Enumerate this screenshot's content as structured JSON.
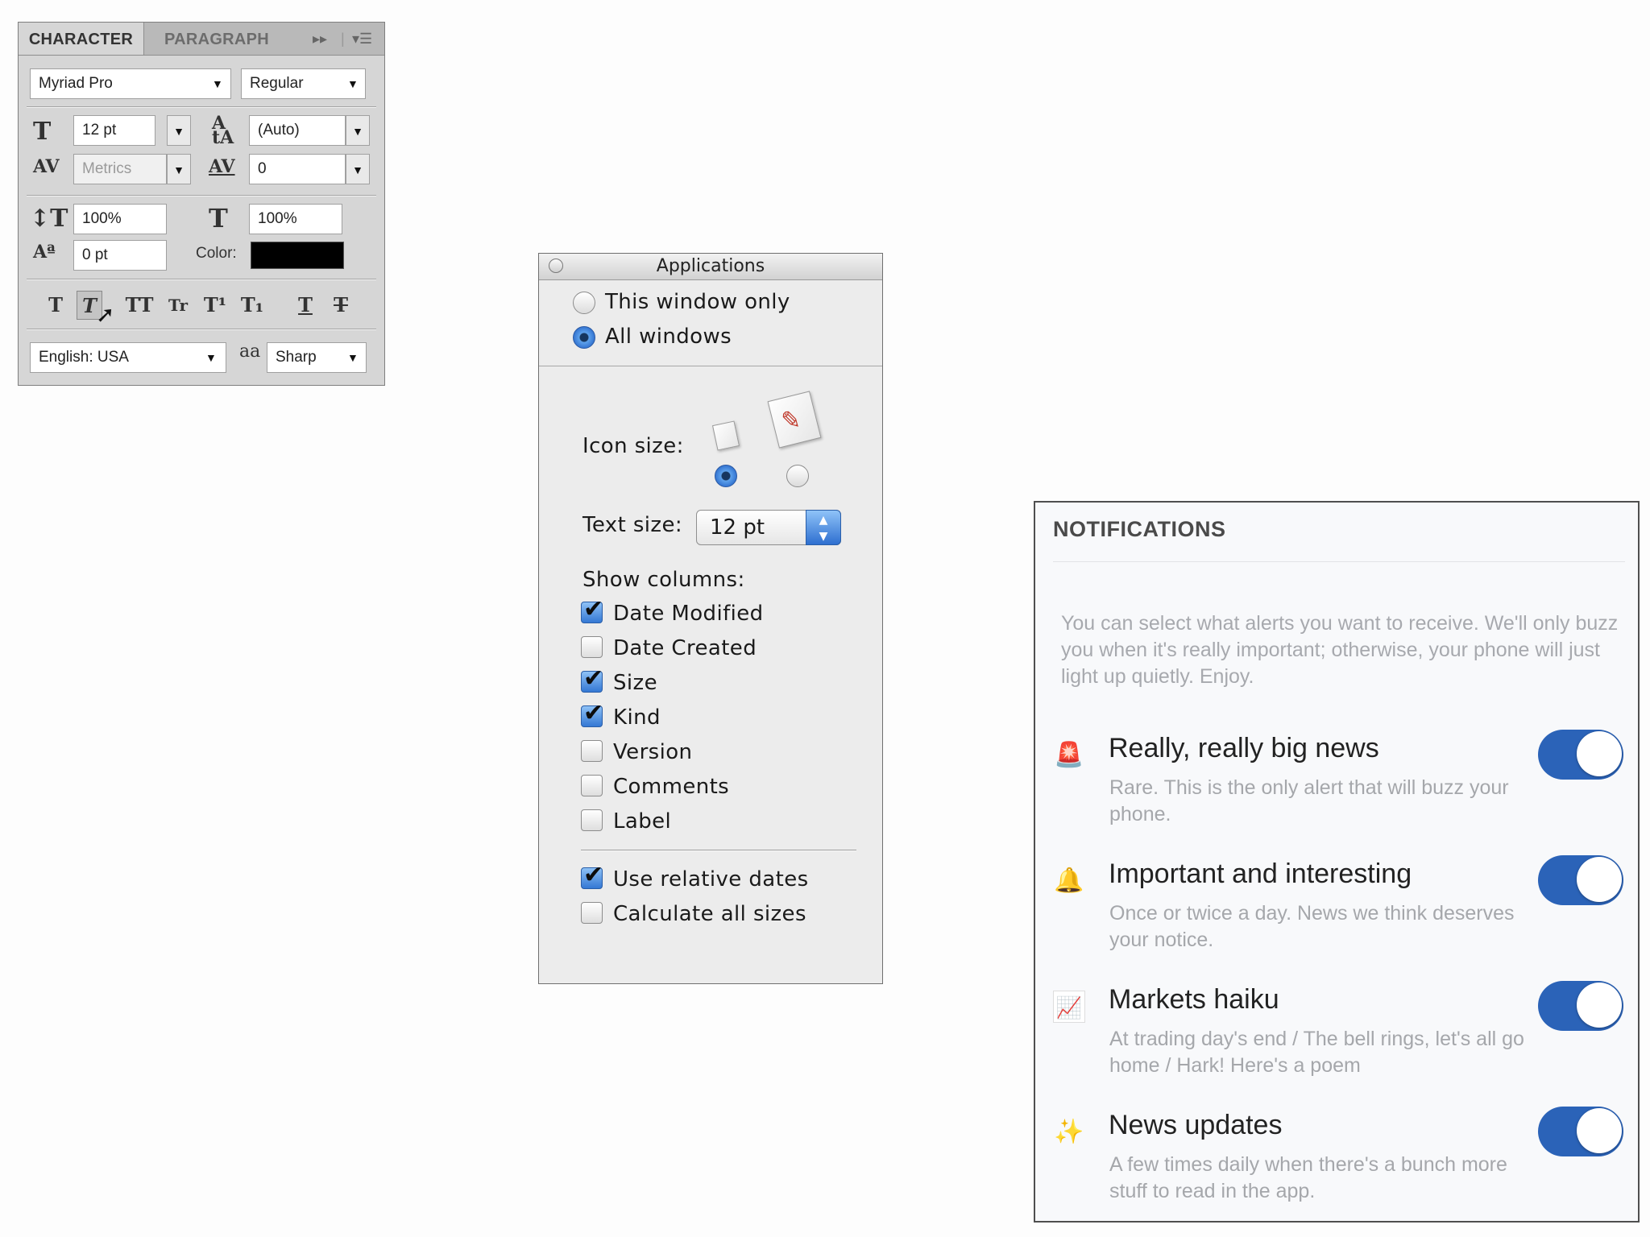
{
  "character_panel": {
    "tabs": [
      "CHARACTER",
      "PARAGRAPH"
    ],
    "font_family": "Myriad Pro",
    "font_style": "Regular",
    "font_size": "12 pt",
    "leading": "(Auto)",
    "kerning": "Metrics",
    "tracking": "0",
    "vertical_scale": "100%",
    "horizontal_scale": "100%",
    "baseline_shift": "0 pt",
    "color_label": "Color:",
    "color_value": "#000000",
    "style_buttons": [
      "T",
      "T",
      "TT",
      "Tr",
      "T¹",
      "T₁",
      "T",
      "T"
    ],
    "language": "English: USA",
    "anti_alias_icon": "aa",
    "anti_alias": "Sharp"
  },
  "apps_window": {
    "title": "Applications",
    "scope_options": [
      {
        "label": "This window only",
        "selected": false
      },
      {
        "label": "All windows",
        "selected": true
      }
    ],
    "icon_size_label": "Icon size:",
    "icon_size_selected": "small",
    "text_size_label": "Text size:",
    "text_size": "12 pt",
    "show_columns_label": "Show columns:",
    "columns": [
      {
        "label": "Date Modified",
        "checked": true
      },
      {
        "label": "Date Created",
        "checked": false
      },
      {
        "label": "Size",
        "checked": true
      },
      {
        "label": "Kind",
        "checked": true
      },
      {
        "label": "Version",
        "checked": false
      },
      {
        "label": "Comments",
        "checked": false
      },
      {
        "label": "Label",
        "checked": false
      }
    ],
    "options": [
      {
        "label": "Use relative dates",
        "checked": true
      },
      {
        "label": "Calculate all sizes",
        "checked": false
      }
    ]
  },
  "notifications": {
    "title": "NOTIFICATIONS",
    "intro": "You can select what alerts you want to receive. We'll only buzz you when it's really important; otherwise, your phone will just light up quietly. Enjoy.",
    "accent": "#2b63b8",
    "items": [
      {
        "icon": "siren-icon",
        "title": "Really, really big news",
        "desc": "Rare. This is the only alert that will buzz your phone.",
        "enabled": true
      },
      {
        "icon": "bell-icon",
        "title": "Important and interesting",
        "desc": "Once or twice a day. News we think deserves your notice.",
        "enabled": true
      },
      {
        "icon": "chart-icon",
        "title": "Markets haiku",
        "desc": "At trading day's end / The bell rings, let's all go home / Hark! Here's a poem",
        "enabled": true
      },
      {
        "icon": "sparkles-icon",
        "title": "News updates",
        "desc": "A few times daily when there's a bunch more stuff to read in the app.",
        "enabled": true
      }
    ]
  }
}
